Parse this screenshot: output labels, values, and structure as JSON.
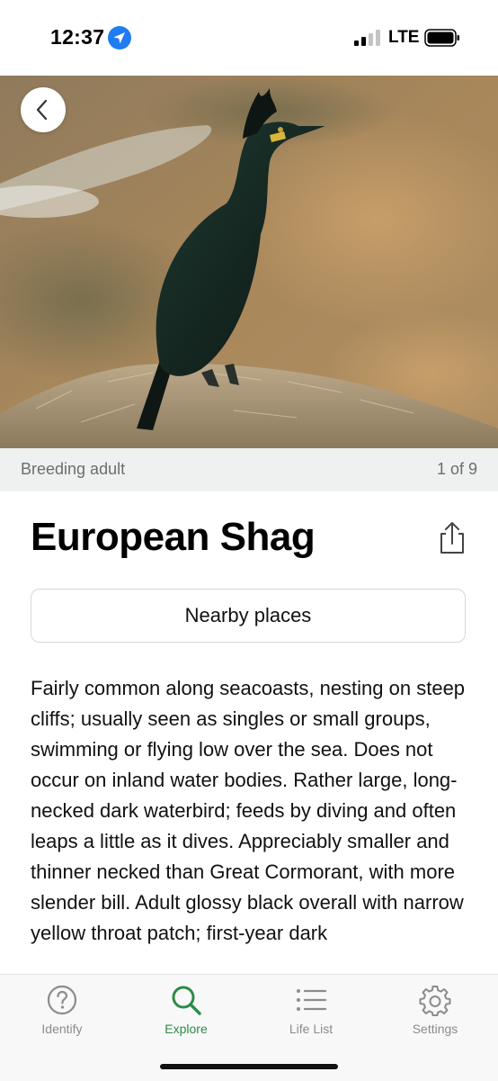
{
  "status_bar": {
    "time": "12:37",
    "network": "LTE"
  },
  "photo": {
    "caption": "Breeding adult",
    "counter": "1 of 9"
  },
  "species": {
    "name": "European Shag",
    "nearby_label": "Nearby places",
    "description": "Fairly common along seacoasts, nesting on steep cliffs; usually seen as singles or small groups, swimming or flying low over the sea. Does not occur on inland water bodies. Rather large, long-necked dark waterbird; feeds by diving and often leaps a little as it dives. Appreciably smaller and thinner necked than Great Cormorant, with more slender bill. Adult glossy black overall with narrow yellow throat patch; first-year dark"
  },
  "tabs": [
    {
      "label": "Identify",
      "icon": "question-circle-icon"
    },
    {
      "label": "Explore",
      "icon": "search-icon"
    },
    {
      "label": "Life List",
      "icon": "list-icon"
    },
    {
      "label": "Settings",
      "icon": "gear-icon"
    }
  ],
  "colors": {
    "accent": "#2e8b47",
    "caption_bg": "#eef1f0",
    "tab_inactive": "#8a8d8c"
  }
}
